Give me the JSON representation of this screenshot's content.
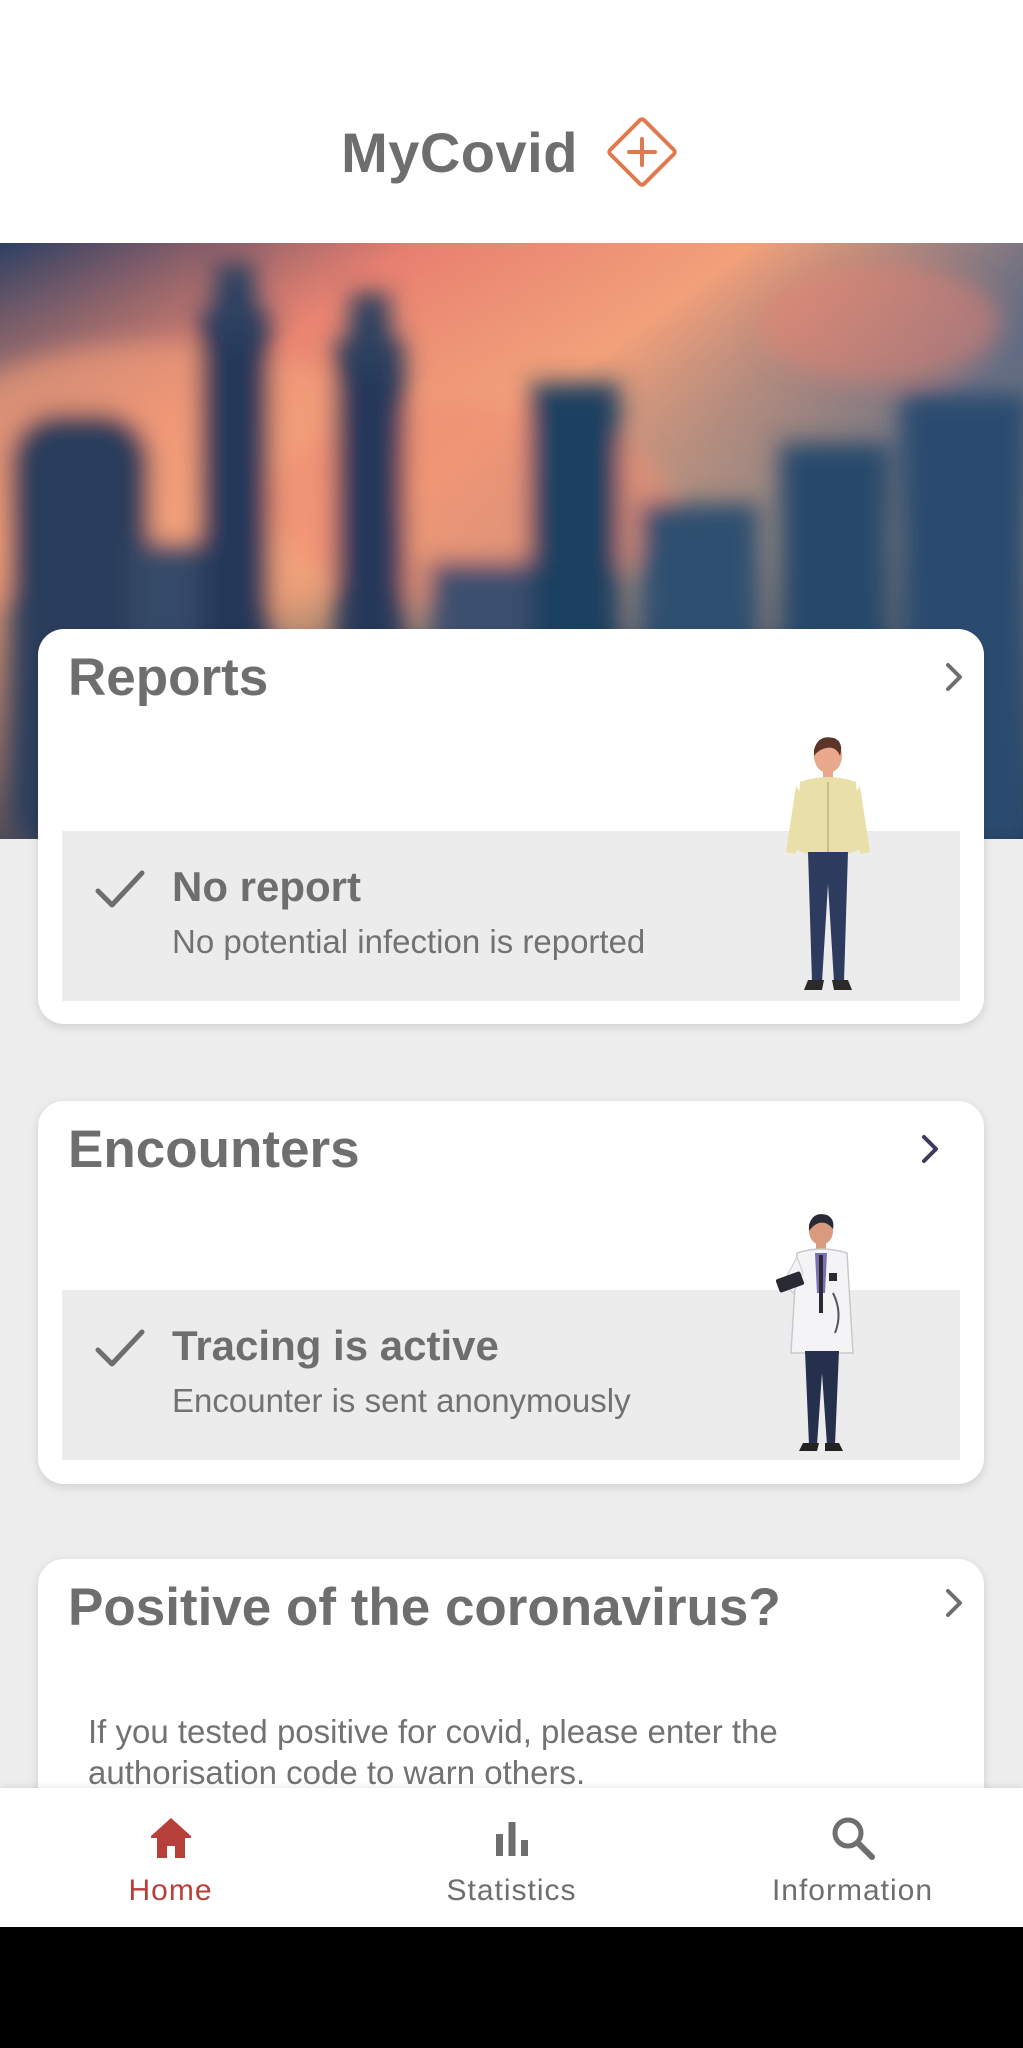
{
  "header": {
    "app_title": "MyCovid",
    "logo_icon": "diamond-plus-icon",
    "accent_color": "#e07a4e"
  },
  "hero": {
    "image": "city-skyline-sunset-blurred"
  },
  "reports_card": {
    "title": "Reports",
    "status_title": "No report",
    "status_description": "No potential infection is reported",
    "status_icon": "check-icon",
    "illustration": "standing-man-illustration"
  },
  "encounters_card": {
    "title": "Encounters",
    "status_title": "Tracing is active",
    "status_description": "Encounter is sent anonymously",
    "status_icon": "check-icon",
    "illustration": "doctor-illustration"
  },
  "positive_card": {
    "title": "Positive of the coronavirus?",
    "body": "If you tested positive for covid, please enter the authorisation code to warn others."
  },
  "bottom_nav": {
    "items": [
      {
        "label": "Home",
        "icon": "home-icon",
        "active": true
      },
      {
        "label": "Statistics",
        "icon": "bar-chart-icon",
        "active": false
      },
      {
        "label": "Information",
        "icon": "search-icon",
        "active": false
      }
    ],
    "active_color": "#b8403a",
    "inactive_color": "#6e6e6e"
  }
}
